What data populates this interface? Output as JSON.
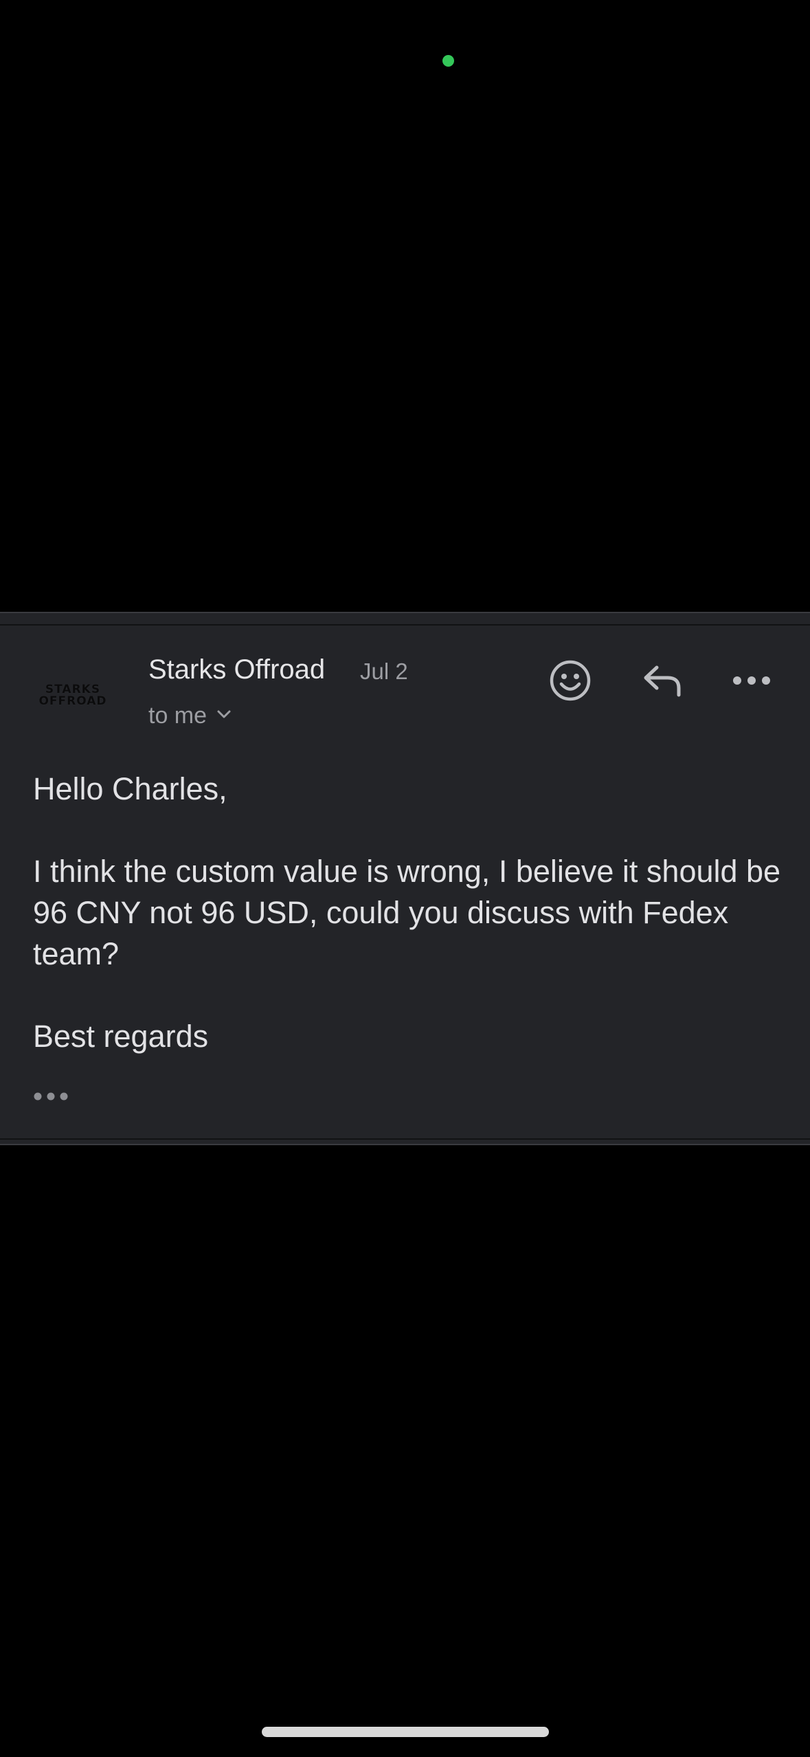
{
  "email": {
    "sender_name": "Starks Offroad",
    "date": "Jul 2",
    "recipient_label": "to me",
    "avatar": {
      "line1": "STARKS",
      "line2": "OFFROAD"
    },
    "body": {
      "greeting": "Hello Charles,",
      "paragraph": "I think the custom value is wrong, I believe it should be 96 CNY not 96 USD, could you discuss with Fedex team?",
      "closing": "Best regards"
    }
  },
  "icons": {
    "status": "camera-indicator",
    "react": "emoji-icon",
    "reply": "reply-icon",
    "more": "more-icon",
    "expand_recipients": "chevron-down-icon",
    "trimmed_content": "ellipsis-icon"
  },
  "colors": {
    "background": "#000000",
    "card": "#232428",
    "primary_text": "#e6e6e8",
    "secondary_text": "#9d9ea3",
    "camera_indicator": "#34c759"
  }
}
